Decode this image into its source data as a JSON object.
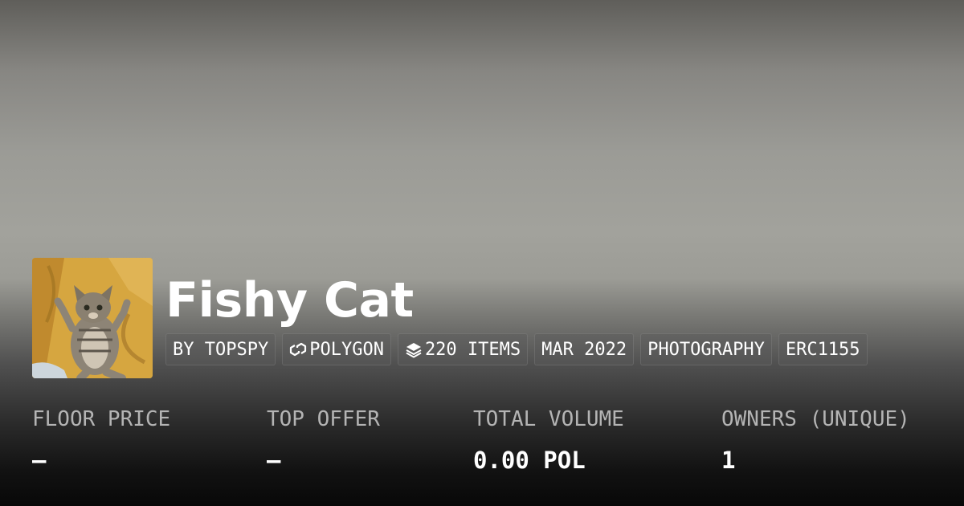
{
  "collection": {
    "name": "Fishy Cat",
    "avatar_icon": "kitten-photo"
  },
  "tags": {
    "creator": "BY TOPSPY",
    "chain": "POLYGON",
    "chain_icon": "polygon-chain-icon",
    "items": "220 ITEMS",
    "items_icon": "layers-icon",
    "date": "MAR 2022",
    "category": "PHOTOGRAPHY",
    "standard": "ERC1155"
  },
  "stats": {
    "floor_price": {
      "label": "FLOOR PRICE",
      "value": "–"
    },
    "top_offer": {
      "label": "TOP OFFER",
      "value": "–"
    },
    "total_volume": {
      "label": "TOTAL VOLUME",
      "value": "0.00 POL"
    },
    "owners": {
      "label": "OWNERS (UNIQUE)",
      "value": "1"
    }
  },
  "colors": {
    "title_text": "#ffffff",
    "label_text": "#b4b4b4",
    "avatar_background": "#d4a43c"
  }
}
